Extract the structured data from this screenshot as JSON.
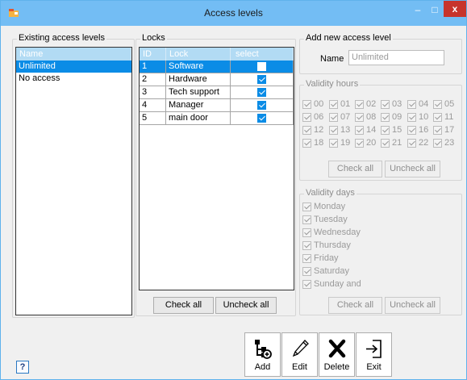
{
  "window": {
    "title": "Access levels"
  },
  "titlebar": {
    "minimize": "–",
    "maximize": "□",
    "close": "x"
  },
  "existing": {
    "label": "Existing access levels",
    "header": "Name",
    "rows": [
      {
        "name": "Unlimited",
        "selected": true
      },
      {
        "name": "No access",
        "selected": false
      }
    ]
  },
  "locks": {
    "label": "Locks",
    "headers": {
      "id": "ID",
      "lock": "Lock",
      "select": "select"
    },
    "rows": [
      {
        "id": "1",
        "lock": "Software",
        "checked": true,
        "selected": true
      },
      {
        "id": "2",
        "lock": "Hardware",
        "checked": true,
        "selected": false
      },
      {
        "id": "3",
        "lock": "Tech support",
        "checked": true,
        "selected": false
      },
      {
        "id": "4",
        "lock": "Manager",
        "checked": true,
        "selected": false
      },
      {
        "id": "5",
        "lock": "main door",
        "checked": true,
        "selected": false
      }
    ],
    "check_all": "Check all",
    "uncheck_all": "Uncheck all"
  },
  "add": {
    "label": "Add new access level",
    "name_label": "Name",
    "name_value": "Unlimited"
  },
  "hours": {
    "label": "Validity hours",
    "items": [
      "00",
      "01",
      "02",
      "03",
      "04",
      "05",
      "06",
      "07",
      "08",
      "09",
      "10",
      "11",
      "12",
      "13",
      "14",
      "15",
      "16",
      "17",
      "18",
      "19",
      "20",
      "21",
      "22",
      "23"
    ],
    "check_all": "Check all",
    "uncheck_all": "Uncheck all"
  },
  "days": {
    "label": "Validity days",
    "items": [
      "Monday",
      "Tuesday",
      "Wednesday",
      "Thursday",
      "Friday",
      "Saturday",
      "Sunday and"
    ],
    "check_all": "Check all",
    "uncheck_all": "Uncheck all"
  },
  "toolbar": {
    "add": "Add",
    "edit": "Edit",
    "delete": "Delete",
    "exit": "Exit"
  },
  "help": "?",
  "colors": {
    "titlebar": "#73bdf4",
    "close": "#c7342c",
    "selection": "#0b8ce6",
    "grid_header": "#b2dbf4"
  }
}
